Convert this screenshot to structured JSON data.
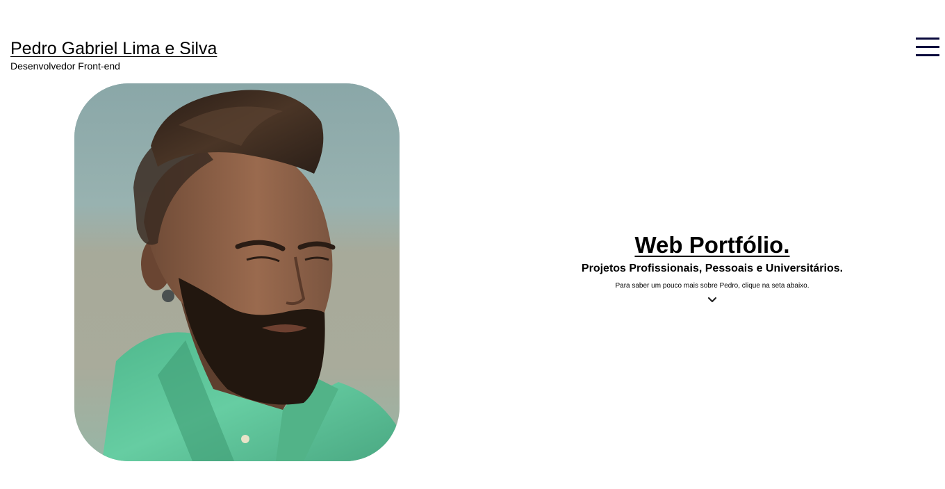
{
  "header": {
    "name": "Pedro Gabriel Lima e Silva",
    "role": "Desenvolvedor Front-end",
    "menu_icon": "hamburger-menu-icon"
  },
  "hero": {
    "title": "Web Portfólio.",
    "subtitle": "Projetos Profissionais, Pessoais e Universitários.",
    "note": "Para saber um pouco mais sobre Pedro, clique na seta abaixo.",
    "arrow_icon": "chevron-down-icon"
  },
  "colors": {
    "menu_bars": "#0a0a3c",
    "text": "#000000",
    "background": "#ffffff",
    "shirt": "#5fc79a"
  }
}
